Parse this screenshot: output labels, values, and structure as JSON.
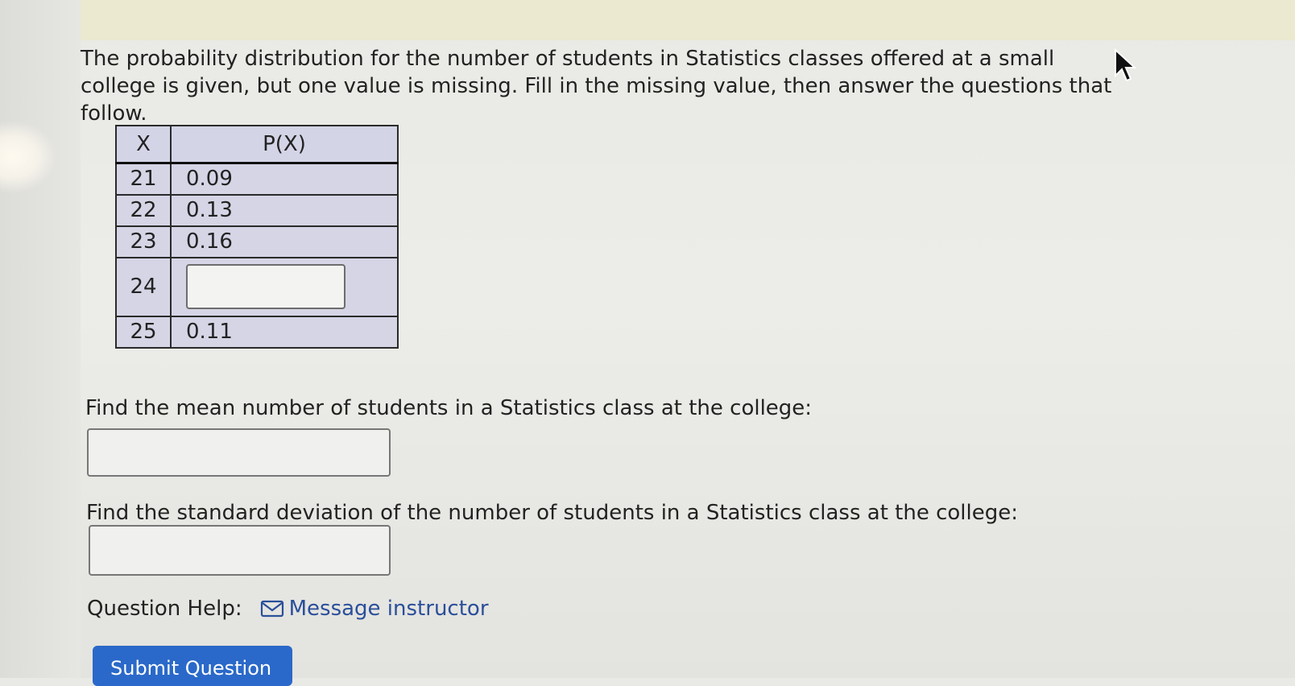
{
  "question": {
    "text": "The probability distribution for the number of students in Statistics classes offered at a small college is given, but one value is missing. Fill in the missing value, then answer the questions that follow."
  },
  "table": {
    "headers": [
      "X",
      "P(X)"
    ],
    "rows": [
      {
        "x": "21",
        "p": "0.09"
      },
      {
        "x": "22",
        "p": "0.13"
      },
      {
        "x": "23",
        "p": "0.16"
      },
      {
        "x": "24",
        "p": ""
      },
      {
        "x": "25",
        "p": "0.11"
      }
    ],
    "missing_value": ""
  },
  "mean_question": {
    "prompt": "Find the mean number of students in a Statistics class at the college:",
    "value": ""
  },
  "sd_question": {
    "prompt": "Find the standard deviation of the number of students in a Statistics class at the college:",
    "value": ""
  },
  "help": {
    "label": "Question Help:",
    "link_text": "Message instructor",
    "icon": "envelope-icon"
  },
  "submit": {
    "label": "Submit Question"
  },
  "colors": {
    "table_fill": "#d5d5e6",
    "link": "#2a4f9a",
    "submit_bg": "#2a69c9"
  }
}
